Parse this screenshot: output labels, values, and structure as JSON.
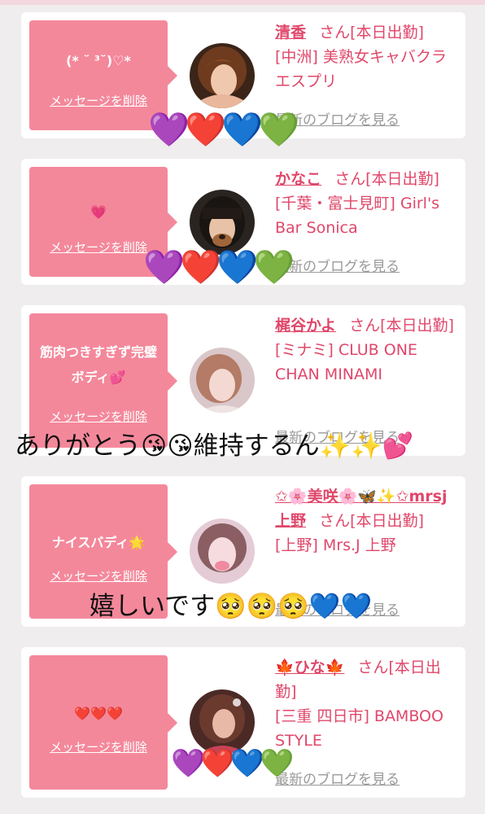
{
  "cards": [
    {
      "message": "(* ˘ ³˘)♡*",
      "delete_label": "メッセージを削除",
      "name": "清香",
      "san_label": "さん[本日出勤]",
      "shop": "[中洲] 美熟女キャバクラ エスプリ",
      "blog_label": "最新のブログを見る",
      "hearts": "💜❤️💙💚"
    },
    {
      "message": "💗",
      "delete_label": "メッセージを削除",
      "name": "かなこ",
      "san_label": "さん[本日出勤]",
      "shop": "[千葉・富士見町] Girl's Bar Sonica",
      "blog_label": "最新のブログを見る",
      "hearts": "💜❤️💙💚"
    },
    {
      "message": "筋肉つきすぎず完璧ボディ💕",
      "delete_label": "メッセージを削除",
      "name": "梶谷かよ",
      "san_label": "さん[本日出勤]",
      "shop": "[ミナミ] CLUB ONE CHAN MINAMI",
      "blog_label": "最新のブログを見る"
    },
    {
      "message": "ナイスバディ🌟",
      "delete_label": "メッセージを削除",
      "name": "✩🌸美咲🌸🦋✨✩mrsj上野",
      "san_label": "さん[本日出勤]",
      "shop": "[上野] Mrs.J 上野",
      "blog_label": "最新のブログを見る"
    },
    {
      "message": "❤️❤️❤️",
      "delete_label": "メッセージを削除",
      "name": "🍁ひな🍁",
      "san_label": "さん[本日出勤]",
      "shop": "[三重 四日市] BAMBOO STYLE",
      "blog_label": "最新のブログを見る",
      "hearts": "💜❤️💙💚"
    }
  ],
  "overlays": {
    "thanks": "ありがとう😘😘維持するん✨✨💕",
    "happy": "嬉しいです🥺🥺🥺💙💙"
  },
  "colors": {
    "bubble": "#f4889b",
    "accent": "#e0476a",
    "background": "#efedee"
  }
}
